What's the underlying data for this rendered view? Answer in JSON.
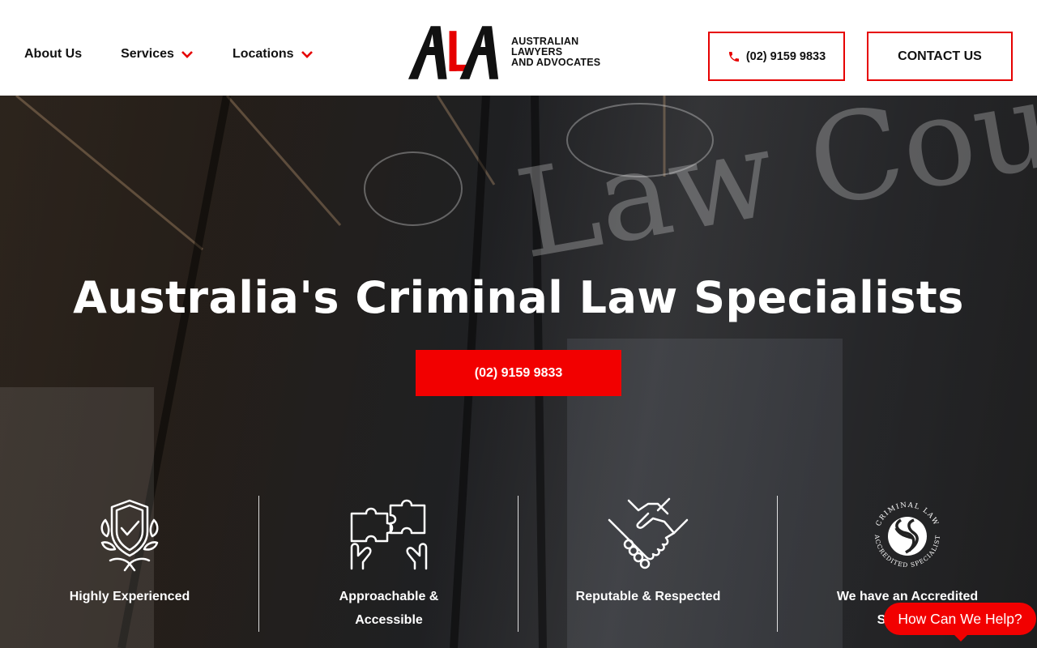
{
  "header": {
    "nav": [
      {
        "label": "About Us",
        "has_dropdown": false
      },
      {
        "label": "Services",
        "has_dropdown": true
      },
      {
        "label": "Locations",
        "has_dropdown": true
      }
    ],
    "logo": {
      "mark": "ALA",
      "line1": "AUSTRALIAN LAWYERS",
      "line2": "AND ADVOCATES"
    },
    "phone_button": {
      "label": "(02) 9159 9833",
      "icon": "phone-icon"
    },
    "contact_button": {
      "label": "CONTACT US"
    }
  },
  "hero": {
    "title": "Australia's Criminal Law Specialists",
    "cta_label": "(02) 9159 9833",
    "background_signage": "Law Courts"
  },
  "features": [
    {
      "icon": "shield-laurel-icon",
      "label_line1": "Highly Experienced",
      "label_line2": ""
    },
    {
      "icon": "puzzle-hands-icon",
      "label_line1": "Approachable &",
      "label_line2": "Accessible"
    },
    {
      "icon": "handshake-icon",
      "label_line1": "Reputable & Respected",
      "label_line2": ""
    },
    {
      "icon": "accredited-specialist-badge-icon",
      "label_line1": "We have an Accredited",
      "label_line2": "Specialist",
      "badge_top": "CRIMINAL LAW",
      "badge_bottom": "ACCREDITED SPECIALIST"
    }
  ],
  "chat_widget": {
    "label": "How Can We Help?"
  },
  "colors": {
    "accent": "#f20000",
    "header_bg": "#ffffff",
    "text_dark": "#111111",
    "hero_text": "#ffffff"
  }
}
